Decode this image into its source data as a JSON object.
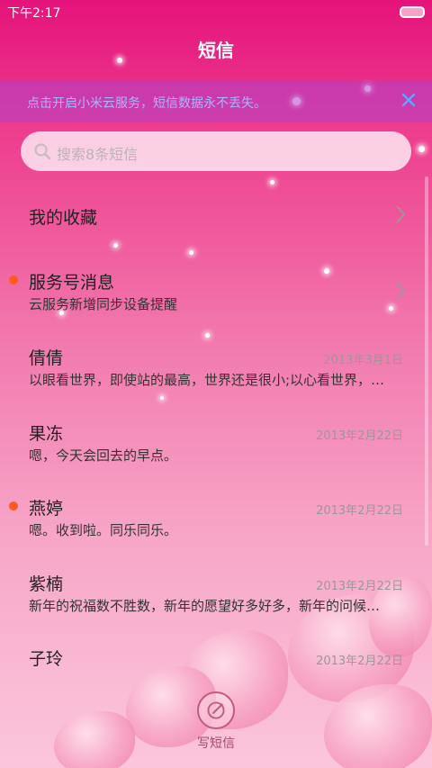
{
  "status_bar": {
    "time": "下午2:17"
  },
  "header": {
    "title": "短信"
  },
  "cloud_banner": {
    "text": "点击开启小米云服务，短信数据永不丢失。"
  },
  "search": {
    "placeholder": "搜索8条短信"
  },
  "list": [
    {
      "name": "我的收藏",
      "preview": "",
      "date": "",
      "unread": false,
      "arrow": true
    },
    {
      "name": "服务号消息",
      "preview": "云服务新增同步设备提醒",
      "date": "",
      "unread": true,
      "arrow": true
    },
    {
      "name": "倩倩",
      "preview": "以眼看世界，即使站的最高，世界还是很小;以心看世界，…",
      "date": "2013年3月1日",
      "unread": false,
      "arrow": false
    },
    {
      "name": "果冻",
      "preview": "嗯，今天会回去的早点。",
      "date": "2013年2月22日",
      "unread": false,
      "arrow": false
    },
    {
      "name": "燕婷",
      "preview": "嗯。收到啦。同乐同乐。",
      "date": "2013年2月22日",
      "unread": true,
      "arrow": false
    },
    {
      "name": "紫楠",
      "preview": "新年的祝福数不胜数，新年的愿望好多好多，新年的问候…",
      "date": "2013年2月22日",
      "unread": false,
      "arrow": false
    },
    {
      "name": "子玲",
      "preview": "",
      "date": "2013年2月22日",
      "unread": false,
      "arrow": false
    }
  ],
  "compose": {
    "label": "写短信"
  }
}
